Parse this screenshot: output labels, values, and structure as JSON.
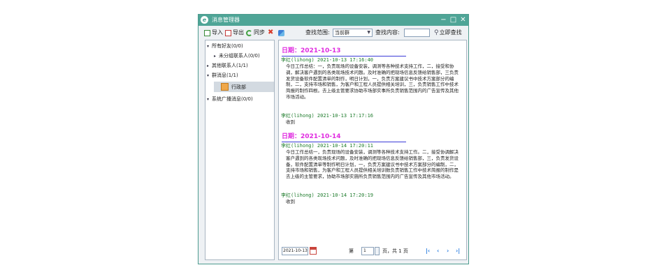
{
  "window": {
    "title": "消息管理器",
    "controls": [
      "−",
      "□",
      "✕"
    ]
  },
  "toolbar": {
    "import_label": "导入",
    "export_label": "导出",
    "sync_label": "同步",
    "scope_label": "查找范围:",
    "scope_value": "当前群",
    "content_label": "查找内容:",
    "search_value": "",
    "search_btn": "立即查找"
  },
  "tree": {
    "items": [
      {
        "label": "所有好友(0/0)",
        "arrow": "▾"
      },
      {
        "label": "未分组联系人(0/0)",
        "arrow": "▸"
      },
      {
        "label": "其他联系人(1/1)",
        "arrow": "▸"
      },
      {
        "label": "群消息(1/1)",
        "arrow": "▾"
      },
      {
        "label": "行政部",
        "arrow": ""
      },
      {
        "label": "系统广播消息(0/0)",
        "arrow": "▾"
      }
    ]
  },
  "messages": {
    "groups": [
      {
        "date": "日期：2021-10-13",
        "entries": [
          {
            "header": "李红(lihong) 2021-10-13 17:16:40",
            "body": "今日工作总结：一，负责现场的设备安装，调测等各种技术支持工作，二，接受和协调，解决客户遇到的各类现场技术问题。及时准确的把现场信息反馈给销售部，三负责发货设备软件配置清单的制作，明日计划，一，负责方案建议书中技术方案部分的编制，二，支持市场和销售，为客户和工程人员提供相关培训，三，负责销售工作中技术简报的制作四根。去上级主管要求协助市场部实事所负责销售范围内的广告宣传及其他市场活动。"
          },
          {
            "header": "李红(lihong) 2021-10-13 17:17:16",
            "body": "收到"
          }
        ]
      },
      {
        "date": "日期：2021-10-14",
        "entries": [
          {
            "header": "李红(lihong) 2021-10-14 17:20:11",
            "body": "今日工作总结一，负责现场的设备安装，调测等各种技术支持工作。二，接受协调解决客户遇到的各类现场技术问题，及时准确的把现场信息反馈给销售部，三，负责发货设备，软件配置清单等制作明日计划，一，负责方案建议书中技术方案部分的编制，二，支持市场和销售，为客户和工程人员提供相关培训数负责销售工作中技术简报的制作是去上级的主管要求，协助市场部实施所负责销售范围内的广告宣传及其他市场活动。"
          },
          {
            "header": "李红(lihong) 2021-10-14 17:20:19",
            "body": "收到"
          }
        ]
      }
    ]
  },
  "pager": {
    "date_value": "2021-10-13",
    "page_prefix": "第",
    "page_value": "1",
    "page_suffix": "页，共 1 页",
    "nav": [
      "|‹",
      "‹",
      "›",
      "›|"
    ]
  },
  "colors": {
    "titlebar": "#4fa597",
    "date_heading": "#e02be0",
    "sender": "#1c7a2a",
    "nav": "#2a7de0"
  },
  "icons": [
    "app-icon",
    "import-icon",
    "export-icon",
    "sync-icon",
    "delete-icon",
    "refresh-icon",
    "search-icon",
    "department-icon",
    "calendar-icon"
  ]
}
